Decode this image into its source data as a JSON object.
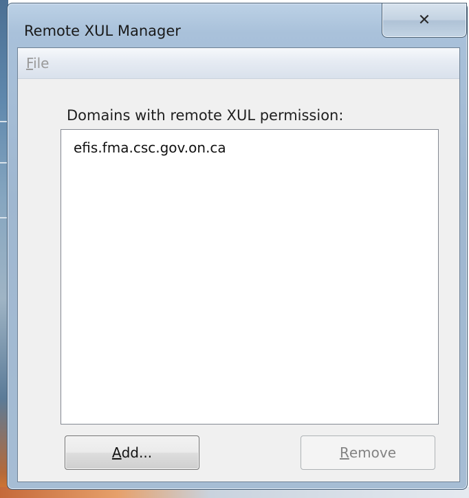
{
  "window": {
    "title": "Remote XUL Manager",
    "close_glyph": "✕"
  },
  "menubar": {
    "file_mnemonic": "F",
    "file_rest": "ile"
  },
  "main": {
    "list_label": "Domains with remote XUL permission:",
    "domains": [
      "efis.fma.csc.gov.on.ca"
    ]
  },
  "buttons": {
    "add_mnemonic": "A",
    "add_rest": "dd...",
    "remove_mnemonic": "R",
    "remove_rest": "emove"
  },
  "colors": {
    "title_bar": "#a9c1da",
    "client_bg": "#f0f0f0",
    "disabled_text": "#838383"
  },
  "icons": {
    "close": "close-icon"
  }
}
